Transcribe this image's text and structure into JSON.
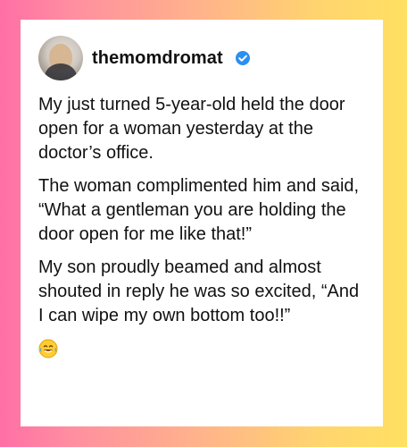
{
  "post": {
    "username": "themomdromat",
    "verified": true,
    "paragraphs": [
      "My just turned 5-year-old held the door open for a woman yesterday at the doctor’s office.",
      "The woman complimented him and said, “What a gentleman you are holding the door open for me like that!”",
      "My son proudly beamed and almost shouted in reply he was so excited, “And I can wipe my own bottom too!!”"
    ],
    "emoji_icon": "laughing-crying-face"
  },
  "colors": {
    "background_left": "#ff6fa6",
    "background_right": "#ffe062",
    "verified_badge": "#2b8ff2"
  }
}
